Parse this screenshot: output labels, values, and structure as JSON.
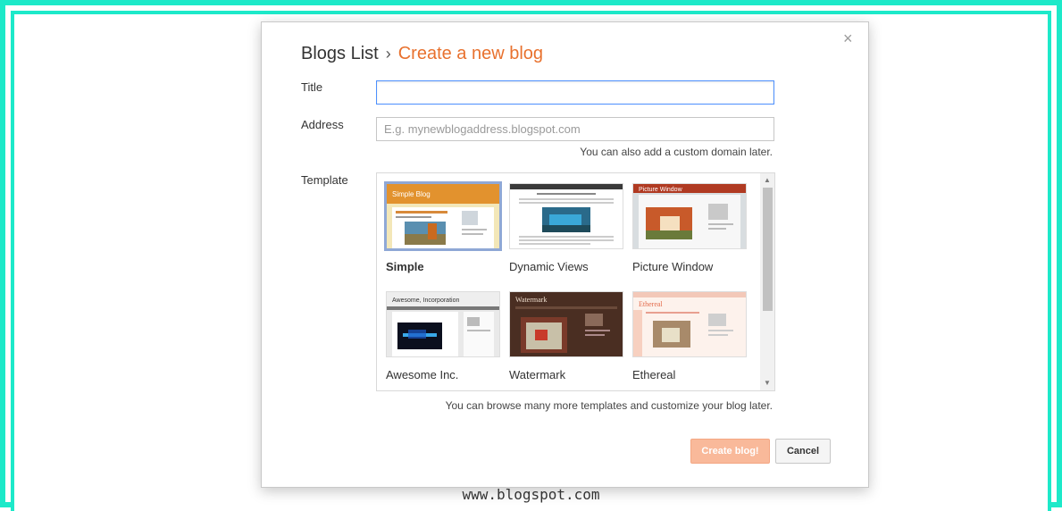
{
  "dialog": {
    "breadcrumb_root": "Blogs List",
    "breadcrumb_sep": "›",
    "breadcrumb_current": "Create a new blog",
    "close_label": "×"
  },
  "form": {
    "title_label": "Title",
    "title_value": "",
    "address_label": "Address",
    "address_placeholder": "E.g. mynewblogaddress.blogspot.com",
    "address_hint": "You can also add a custom domain later.",
    "template_label": "Template",
    "template_hint": "You can browse many more templates and customize your blog later."
  },
  "templates": [
    {
      "name": "Simple",
      "selected": true
    },
    {
      "name": "Dynamic Views",
      "selected": false
    },
    {
      "name": "Picture Window",
      "selected": false
    },
    {
      "name": "Awesome Inc.",
      "selected": false
    },
    {
      "name": "Watermark",
      "selected": false
    },
    {
      "name": "Ethereal",
      "selected": false
    }
  ],
  "thumb_text": {
    "simple": "Simple Blog",
    "picture_window": "Picture Window",
    "awesome": "Awesome, Incorporation",
    "watermark": "Watermark",
    "ethereal": "Ethereal"
  },
  "buttons": {
    "create": "Create blog!",
    "cancel": "Cancel"
  },
  "footer": {
    "url": "www.blogspot.com"
  },
  "colors": {
    "accent_frame": "#1de9c9",
    "breadcrumb_current": "#e8712e",
    "primary_button": "#f9b99a",
    "selected_border": "#8fa8d6"
  }
}
